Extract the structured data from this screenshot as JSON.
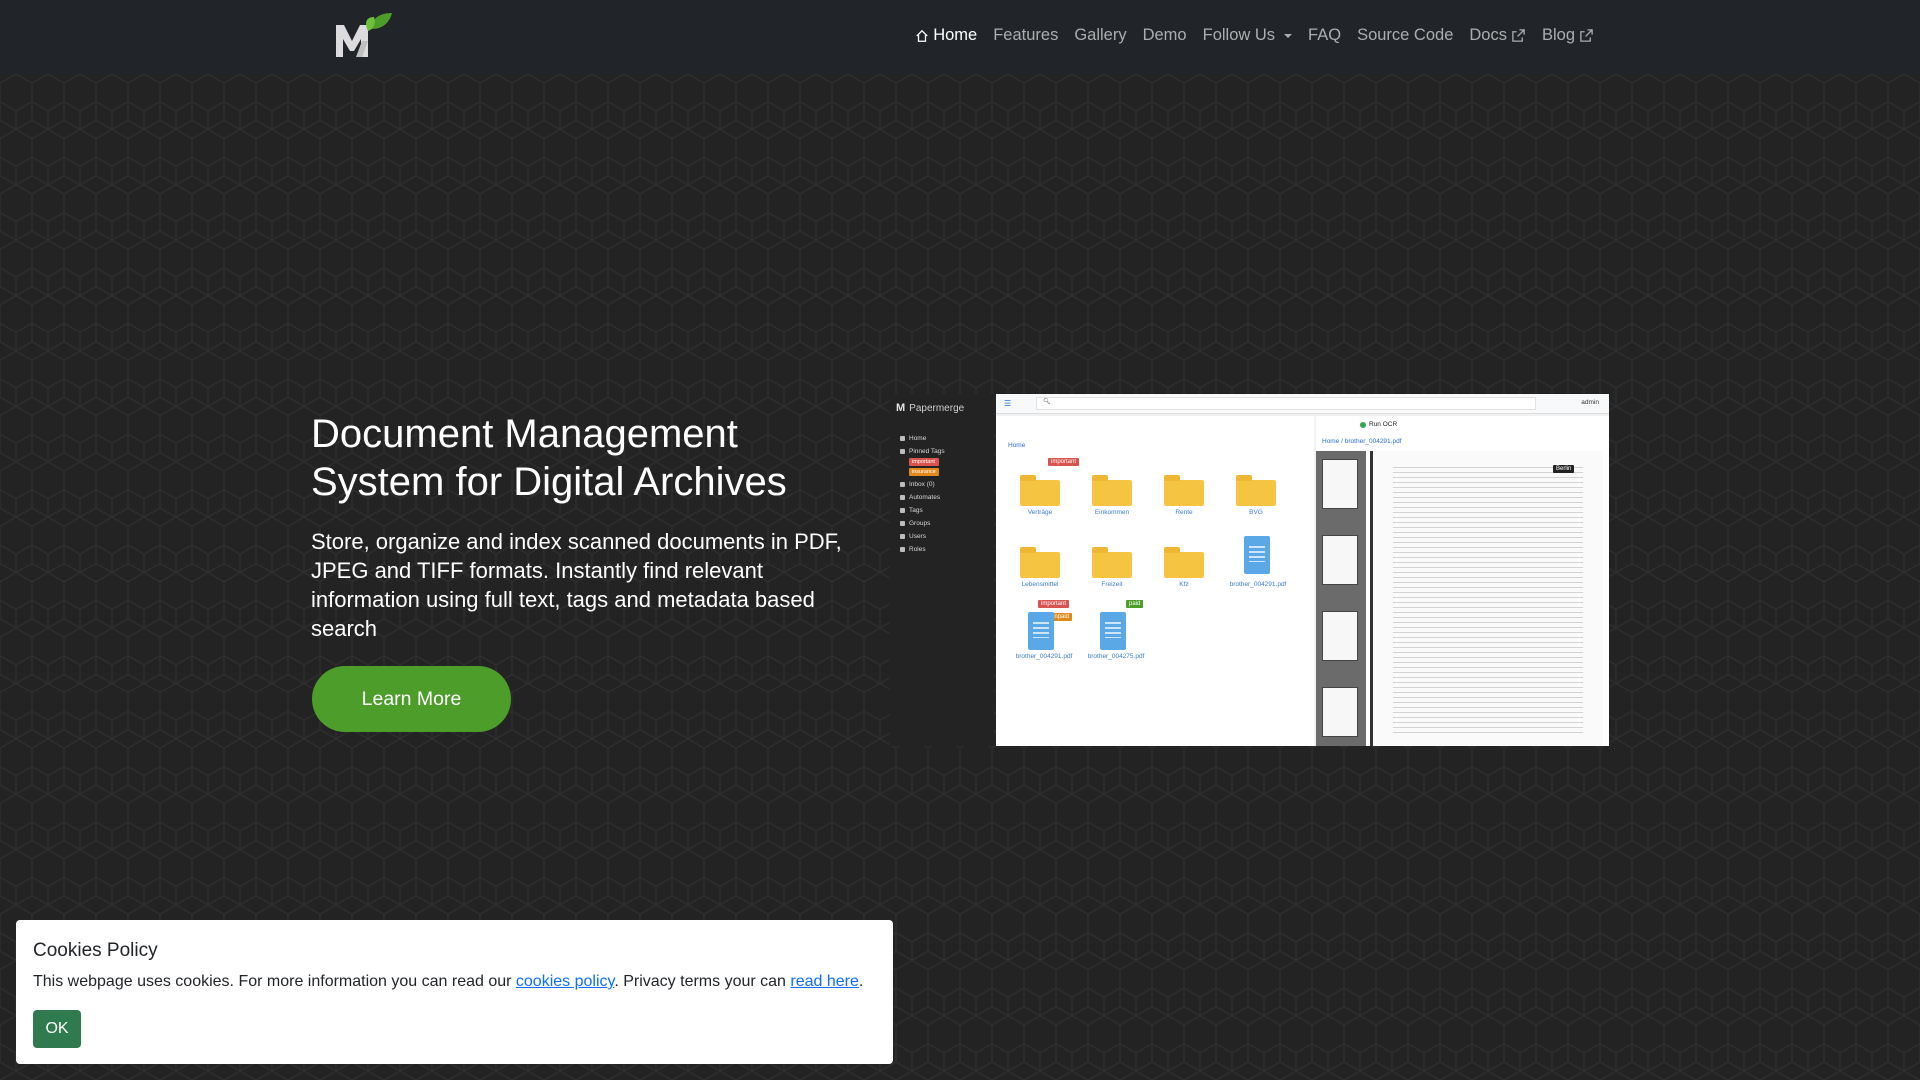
{
  "nav": {
    "items": [
      {
        "label": "Home",
        "icon": "home-icon",
        "active": true
      },
      {
        "label": "Features"
      },
      {
        "label": "Gallery"
      },
      {
        "label": "Demo"
      },
      {
        "label": "Follow Us",
        "dropdown": true
      },
      {
        "label": "FAQ"
      },
      {
        "label": "Source Code"
      },
      {
        "label": "Docs",
        "icon": "external-link-icon"
      },
      {
        "label": "Blog",
        "icon": "external-link-icon"
      }
    ]
  },
  "hero": {
    "title": "Document Management System for Digital Archives",
    "subtitle": "Store, organize and index scanned documents in PDF, JPEG and TIFF formats. Instantly find relevant information using full text, tags and metadata based search",
    "button": "Learn More"
  },
  "screenshot": {
    "brand": "Papermerge",
    "admin": "admin",
    "ocr": "Run OCR",
    "crumb_home": "Home",
    "crumb_doc": "brother_004291.pdf",
    "menu": [
      "Home",
      "Pinned Tags",
      "Inbox (0)",
      "Automates",
      "Tags",
      "Groups",
      "Users",
      "Roles"
    ],
    "pinned_tags": [
      "important",
      "insurance"
    ],
    "folders": [
      "Verträge",
      "Einkommen",
      "Rente",
      "BVG",
      "Lebensmittel",
      "Freizeit",
      "Kfz"
    ],
    "docs": [
      "brother_004291.pdf",
      "brother_004291.pdf",
      "brother_004275.pdf"
    ],
    "badges": [
      "important",
      "important",
      "unpaid",
      "paid"
    ],
    "page_stamp": "Berlin"
  },
  "cookies": {
    "title": "Cookies Policy",
    "text_before": "This webpage uses cookies. For more information you can read our ",
    "link1": "cookies policy",
    "text_middle": ". Privacy terms your can ",
    "link2": "read here",
    "text_after": ".",
    "ok": "OK"
  },
  "colors": {
    "accent_green": "#4c9d2a",
    "ok_green": "#2f7a4f",
    "link_blue": "#0d6efd"
  }
}
